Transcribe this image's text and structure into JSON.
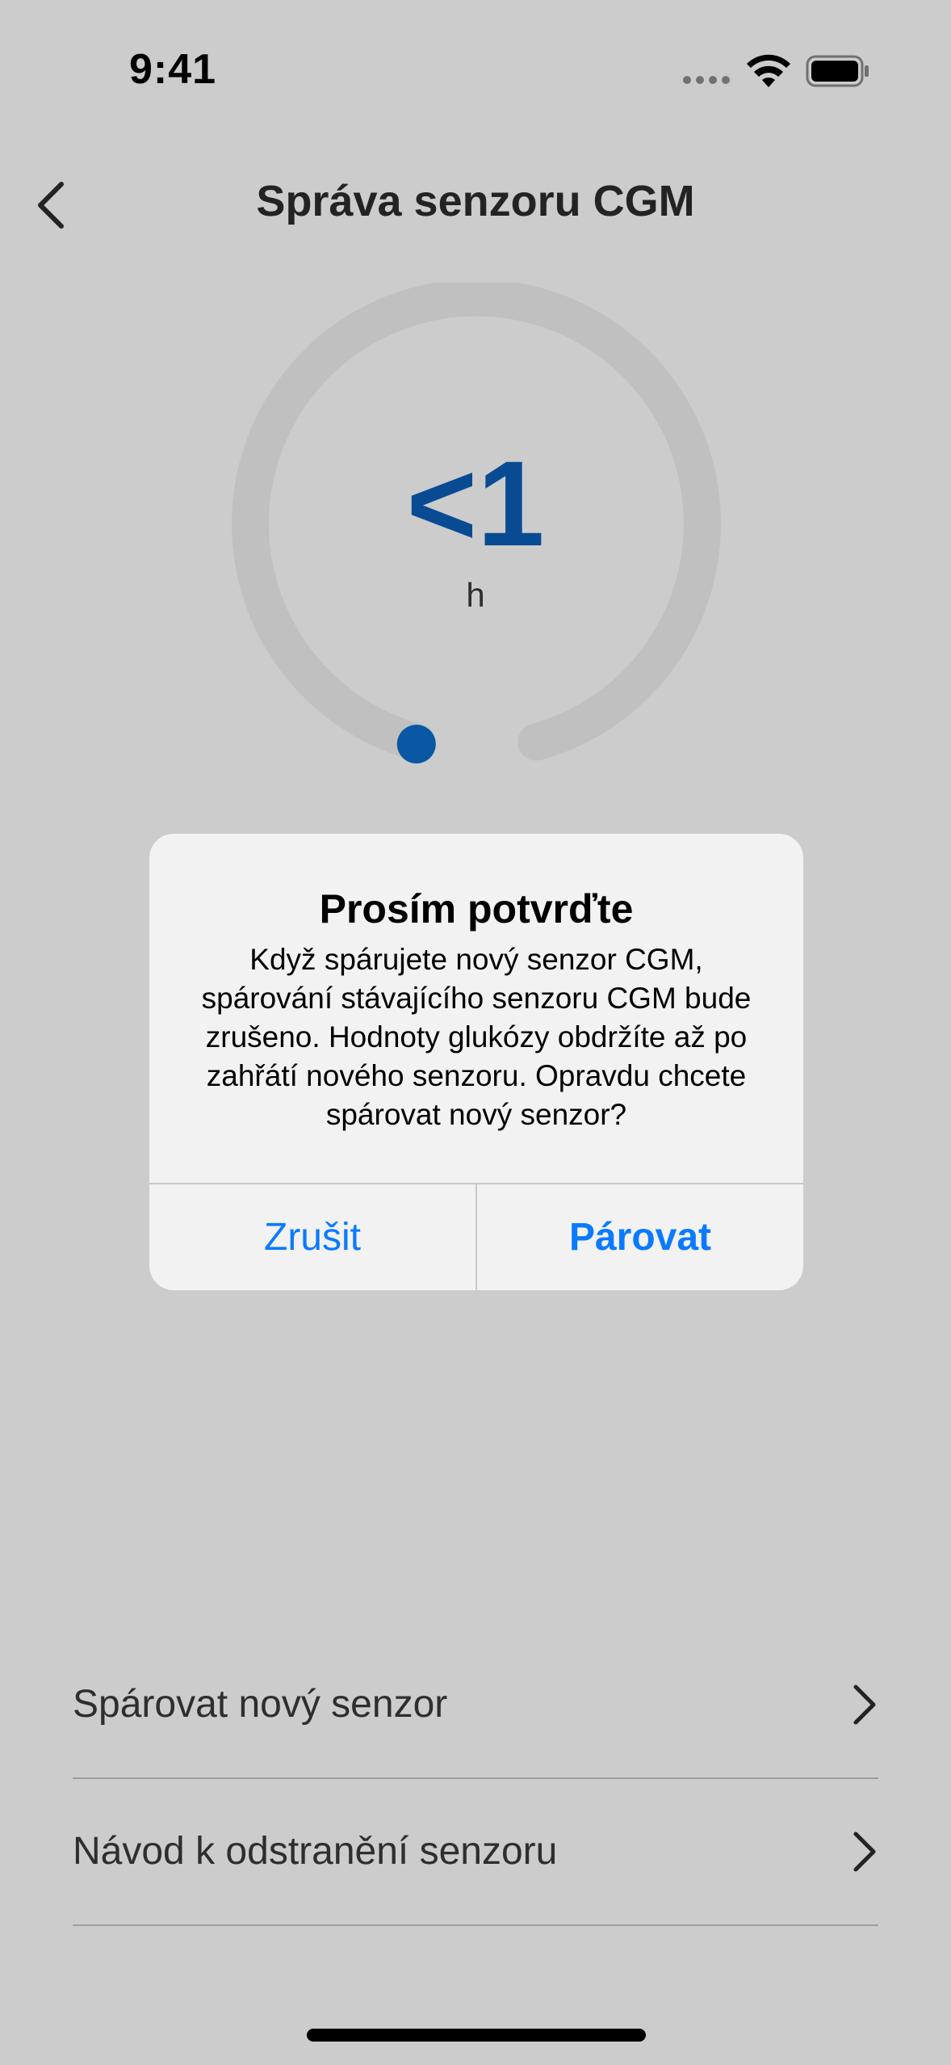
{
  "status_bar": {
    "time": "9:41"
  },
  "nav": {
    "title": "Správa senzoru CGM"
  },
  "gauge": {
    "value": "<1",
    "unit": "h",
    "accent_color": "#0a5eb8",
    "indicator_color": "#0a6fd0"
  },
  "list": {
    "items": [
      {
        "label": "Spárovat nový senzor"
      },
      {
        "label": "Návod k odstranění senzoru"
      }
    ]
  },
  "alert": {
    "title": "Prosím potvrďte",
    "message": "Když spárujete nový senzor CGM, spárování stávajícího senzoru CGM bude zrušeno. Hodnoty glukózy obdržíte až po zahřátí nového senzoru. Opravdu chcete spárovat nový senzor?",
    "cancel_label": "Zrušit",
    "confirm_label": "Párovat",
    "button_color": "#0a7aff"
  },
  "icons": {
    "back": "chevron-left-icon",
    "row": "chevron-right-icon",
    "wifi": "wifi-icon",
    "battery": "battery-icon",
    "signal": "signal-icon"
  }
}
